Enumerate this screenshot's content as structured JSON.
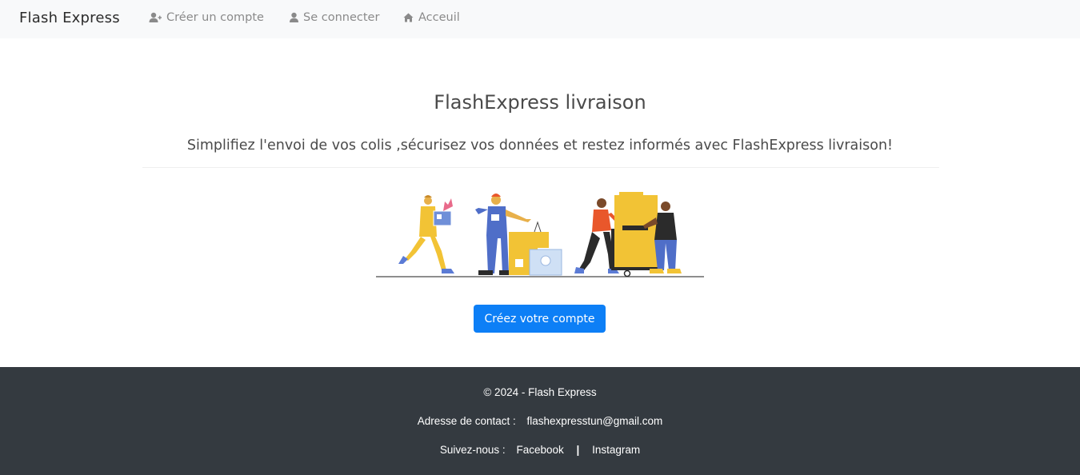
{
  "navbar": {
    "brand": "Flash Express",
    "items": [
      {
        "label": "Créer un compte",
        "icon": "user-plus-icon"
      },
      {
        "label": "Se connecter",
        "icon": "user-icon"
      },
      {
        "label": "Acceuil",
        "icon": "home-icon"
      }
    ]
  },
  "hero": {
    "title": "FlashExpress livraison",
    "subtitle": "Simplifiez l'envoi de vos colis ,sécurisez vos données et restez informés avec FlashExpress livraison!",
    "cta_label": "Créez votre compte"
  },
  "footer": {
    "copyright": "© 2024 - Flash Express",
    "contact_label": "Adresse de contact :",
    "contact_email": "flashexpresstun@gmail.com",
    "follow_label": "Suivez-nous :",
    "facebook": "Facebook",
    "separator": "|",
    "instagram": "Instagram"
  },
  "colors": {
    "navbar_bg": "#f8f9fa",
    "cta_bg": "#0d7ff6",
    "footer_bg": "#343a40"
  }
}
